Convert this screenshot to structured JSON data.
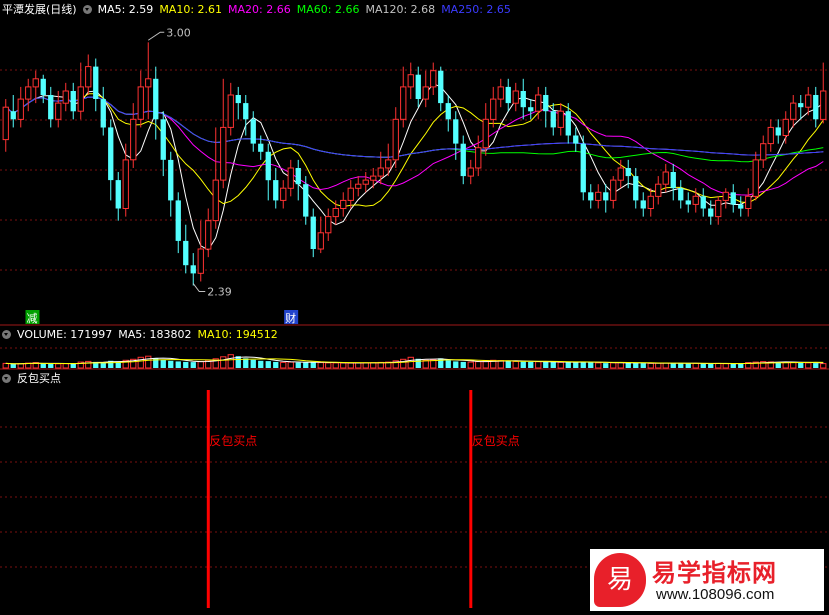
{
  "header": {
    "stock_name": "平潭发展(日线)",
    "ma": [
      {
        "label": "MA5: 2.59",
        "color": "#ffffff"
      },
      {
        "label": "MA10: 2.61",
        "color": "#ffff00"
      },
      {
        "label": "MA20: 2.66",
        "color": "#ff00ff"
      },
      {
        "label": "MA60: 2.66",
        "color": "#00ff00"
      },
      {
        "label": "MA120: 2.68",
        "color": "#c0c0c0"
      },
      {
        "label": "MA250: 2.65",
        "color": "#3b3bff"
      }
    ]
  },
  "volume_header": {
    "volume": "VOLUME: 171997",
    "ma5": "MA5: 183802",
    "ma10": "MA10: 194512"
  },
  "indicator_header": {
    "title": "反包买点"
  },
  "price_annotations": {
    "high": "3.00",
    "low": "2.39"
  },
  "event_markers": [
    "减",
    "财"
  ],
  "signal_label": "反包买点",
  "logo": {
    "badge": "易",
    "title": "易学指标网",
    "url": "www.108096.com"
  },
  "colors": {
    "up": "#ff3232",
    "down": "#54ffff",
    "grid": "#7a1010",
    "border": "#a01818",
    "ma5": "#ffffff",
    "ma10": "#ffff00",
    "ma20": "#ff00ff",
    "ma60": "#00ff00",
    "ma120": "#c0c0c0",
    "ma250": "#3b3bff",
    "signal": "#ff0000"
  },
  "chart_data": [
    {
      "type": "candlestick",
      "title": "平潭发展(日线)",
      "ylim": [
        2.3,
        3.05
      ],
      "extremes": {
        "high": 3.0,
        "low": 2.39
      },
      "candles": [
        [
          2.75,
          2.83,
          2.72,
          2.85
        ],
        [
          2.82,
          2.8,
          2.78,
          2.86
        ],
        [
          2.8,
          2.85,
          2.78,
          2.88
        ],
        [
          2.85,
          2.88,
          2.82,
          2.9
        ],
        [
          2.88,
          2.9,
          2.84,
          2.92
        ],
        [
          2.9,
          2.86,
          2.84,
          2.91
        ],
        [
          2.86,
          2.8,
          2.78,
          2.88
        ],
        [
          2.8,
          2.84,
          2.78,
          2.87
        ],
        [
          2.84,
          2.87,
          2.82,
          2.89
        ],
        [
          2.87,
          2.82,
          2.8,
          2.89
        ],
        [
          2.82,
          2.88,
          2.8,
          2.94
        ],
        [
          2.88,
          2.93,
          2.86,
          2.96
        ],
        [
          2.93,
          2.85,
          2.82,
          2.95
        ],
        [
          2.85,
          2.78,
          2.76,
          2.88
        ],
        [
          2.78,
          2.65,
          2.6,
          2.8
        ],
        [
          2.65,
          2.58,
          2.55,
          2.67
        ],
        [
          2.58,
          2.7,
          2.56,
          2.74
        ],
        [
          2.7,
          2.8,
          2.68,
          2.84
        ],
        [
          2.8,
          2.88,
          2.78,
          2.92
        ],
        [
          2.88,
          2.9,
          2.8,
          2.99
        ],
        [
          2.9,
          2.8,
          2.75,
          2.93
        ],
        [
          2.8,
          2.7,
          2.66,
          2.82
        ],
        [
          2.7,
          2.6,
          2.56,
          2.72
        ],
        [
          2.6,
          2.5,
          2.47,
          2.62
        ],
        [
          2.5,
          2.44,
          2.42,
          2.54
        ],
        [
          2.44,
          2.42,
          2.39,
          2.47
        ],
        [
          2.42,
          2.48,
          2.4,
          2.55
        ],
        [
          2.48,
          2.55,
          2.46,
          2.58
        ],
        [
          2.55,
          2.65,
          2.53,
          2.78
        ],
        [
          2.65,
          2.78,
          2.63,
          2.9
        ],
        [
          2.78,
          2.86,
          2.76,
          2.89
        ],
        [
          2.86,
          2.84,
          2.8,
          2.88
        ],
        [
          2.84,
          2.8,
          2.76,
          2.86
        ],
        [
          2.8,
          2.74,
          2.72,
          2.82
        ],
        [
          2.74,
          2.72,
          2.7,
          2.76
        ],
        [
          2.72,
          2.65,
          2.6,
          2.74
        ],
        [
          2.65,
          2.6,
          2.58,
          2.68
        ],
        [
          2.6,
          2.63,
          2.58,
          2.65
        ],
        [
          2.63,
          2.68,
          2.61,
          2.7
        ],
        [
          2.68,
          2.64,
          2.6,
          2.7
        ],
        [
          2.64,
          2.56,
          2.54,
          2.66
        ],
        [
          2.56,
          2.48,
          2.46,
          2.58
        ],
        [
          2.48,
          2.52,
          2.47,
          2.56
        ],
        [
          2.52,
          2.56,
          2.5,
          2.58
        ],
        [
          2.56,
          2.58,
          2.54,
          2.6
        ],
        [
          2.58,
          2.6,
          2.56,
          2.62
        ],
        [
          2.6,
          2.63,
          2.58,
          2.65
        ],
        [
          2.63,
          2.64,
          2.61,
          2.66
        ],
        [
          2.64,
          2.65,
          2.62,
          2.67
        ],
        [
          2.65,
          2.66,
          2.63,
          2.68
        ],
        [
          2.66,
          2.68,
          2.64,
          2.72
        ],
        [
          2.68,
          2.7,
          2.66,
          2.74
        ],
        [
          2.7,
          2.8,
          2.68,
          2.83
        ],
        [
          2.8,
          2.88,
          2.78,
          2.93
        ],
        [
          2.88,
          2.91,
          2.85,
          2.94
        ],
        [
          2.91,
          2.85,
          2.83,
          2.93
        ],
        [
          2.85,
          2.88,
          2.83,
          2.92
        ],
        [
          2.88,
          2.92,
          2.86,
          2.94
        ],
        [
          2.92,
          2.84,
          2.82,
          2.93
        ],
        [
          2.84,
          2.8,
          2.77,
          2.86
        ],
        [
          2.8,
          2.74,
          2.7,
          2.82
        ],
        [
          2.74,
          2.66,
          2.64,
          2.76
        ],
        [
          2.66,
          2.68,
          2.64,
          2.7
        ],
        [
          2.68,
          2.73,
          2.66,
          2.76
        ],
        [
          2.73,
          2.8,
          2.71,
          2.84
        ],
        [
          2.8,
          2.85,
          2.78,
          2.88
        ],
        [
          2.85,
          2.88,
          2.83,
          2.9
        ],
        [
          2.88,
          2.84,
          2.82,
          2.9
        ],
        [
          2.84,
          2.87,
          2.82,
          2.89
        ],
        [
          2.87,
          2.83,
          2.8,
          2.9
        ],
        [
          2.83,
          2.82,
          2.8,
          2.85
        ],
        [
          2.82,
          2.86,
          2.8,
          2.88
        ],
        [
          2.86,
          2.82,
          2.78,
          2.88
        ],
        [
          2.82,
          2.78,
          2.76,
          2.84
        ],
        [
          2.78,
          2.82,
          2.76,
          2.84
        ],
        [
          2.82,
          2.76,
          2.74,
          2.84
        ],
        [
          2.76,
          2.74,
          2.72,
          2.78
        ],
        [
          2.74,
          2.62,
          2.6,
          2.76
        ],
        [
          2.62,
          2.6,
          2.58,
          2.64
        ],
        [
          2.6,
          2.62,
          2.58,
          2.64
        ],
        [
          2.62,
          2.6,
          2.57,
          2.64
        ],
        [
          2.6,
          2.65,
          2.58,
          2.66
        ],
        [
          2.65,
          2.68,
          2.63,
          2.7
        ],
        [
          2.68,
          2.66,
          2.63,
          2.7
        ],
        [
          2.66,
          2.6,
          2.58,
          2.68
        ],
        [
          2.6,
          2.58,
          2.56,
          2.62
        ],
        [
          2.58,
          2.61,
          2.56,
          2.63
        ],
        [
          2.61,
          2.64,
          2.59,
          2.66
        ],
        [
          2.64,
          2.67,
          2.62,
          2.69
        ],
        [
          2.67,
          2.63,
          2.6,
          2.69
        ],
        [
          2.63,
          2.6,
          2.58,
          2.65
        ],
        [
          2.6,
          2.59,
          2.57,
          2.62
        ],
        [
          2.59,
          2.61,
          2.57,
          2.63
        ],
        [
          2.61,
          2.58,
          2.56,
          2.63
        ],
        [
          2.58,
          2.56,
          2.54,
          2.6
        ],
        [
          2.56,
          2.6,
          2.54,
          2.61
        ],
        [
          2.6,
          2.62,
          2.58,
          2.63
        ],
        [
          2.62,
          2.59,
          2.57,
          2.64
        ],
        [
          2.59,
          2.58,
          2.56,
          2.61
        ],
        [
          2.58,
          2.61,
          2.56,
          2.63
        ],
        [
          2.61,
          2.7,
          2.6,
          2.72
        ],
        [
          2.7,
          2.74,
          2.68,
          2.76
        ],
        [
          2.74,
          2.78,
          2.72,
          2.8
        ],
        [
          2.78,
          2.76,
          2.74,
          2.8
        ],
        [
          2.76,
          2.8,
          2.74,
          2.82
        ],
        [
          2.8,
          2.84,
          2.78,
          2.86
        ],
        [
          2.84,
          2.83,
          2.8,
          2.86
        ],
        [
          2.83,
          2.86,
          2.81,
          2.88
        ],
        [
          2.86,
          2.8,
          2.78,
          2.88
        ],
        [
          2.8,
          2.87,
          2.79,
          2.94
        ]
      ]
    },
    {
      "type": "bar",
      "title": "VOLUME",
      "ylim": [
        0,
        900000
      ],
      "values": [
        180000,
        160000,
        170000,
        190000,
        210000,
        175000,
        160000,
        165000,
        170000,
        180000,
        230000,
        260000,
        240000,
        220000,
        280000,
        260000,
        300000,
        340000,
        420000,
        460000,
        380000,
        330000,
        280000,
        260000,
        240000,
        230000,
        250000,
        300000,
        360000,
        440000,
        520000,
        460000,
        380000,
        320000,
        280000,
        270000,
        240000,
        220000,
        230000,
        210000,
        220000,
        240000,
        210000,
        200000,
        200000,
        195000,
        190000,
        200000,
        205000,
        210000,
        220000,
        230000,
        280000,
        340000,
        420000,
        360000,
        300000,
        320000,
        380000,
        300000,
        260000,
        240000,
        230000,
        250000,
        280000,
        300000,
        290000,
        270000,
        260000,
        250000,
        240000,
        245000,
        235000,
        230000,
        225000,
        220000,
        230000,
        250000,
        220000,
        200000,
        190000,
        205000,
        210000,
        200000,
        190000,
        185000,
        180000,
        190000,
        195000,
        185000,
        180000,
        175000,
        180000,
        170000,
        175000,
        180000,
        170000,
        165000,
        175000,
        210000,
        230000,
        250000,
        240000,
        230000,
        235000,
        220000,
        210000,
        200000,
        190000,
        171997
      ]
    },
    {
      "type": "signal",
      "title": "反包买点",
      "signal_indices": [
        27,
        62
      ]
    }
  ]
}
